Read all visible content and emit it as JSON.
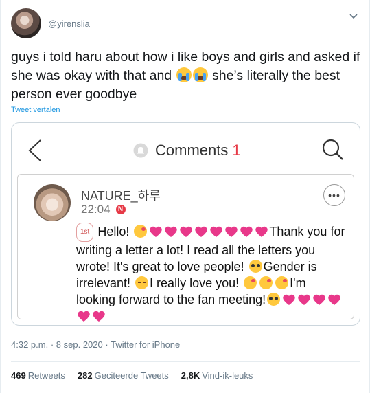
{
  "author": {
    "handle": "@yirenslia"
  },
  "tweet": {
    "text_part1": "guys i told haru about how i like boys and girls and asked if she was okay with that and",
    "text_part2": "she’s literally the best person ever goodbye",
    "emoji": "loudly-crying-face",
    "translate_label": "Tweet vertalen"
  },
  "screenshot": {
    "title": "Comments",
    "count": "1",
    "comment": {
      "name": "NATURE_하루",
      "time": "22:04",
      "new_badge": "N",
      "rank": "1st",
      "more_label": "•••",
      "line1": "Hello!",
      "line2": "Thank you for writing a letter a lot!  I read all the letters you wrote!  It's great to love people!",
      "line3": "Gender is irrelevant!",
      "line4": "I really love you!",
      "line5": "I'm looking forward to the fan meeting!"
    }
  },
  "meta": {
    "time": "4:32 p.m.",
    "date": "8 sep. 2020",
    "source": "Twitter for iPhone",
    "sep": "·"
  },
  "stats": {
    "retweets_count": "469",
    "retweets_label": "Retweets",
    "quotes_count": "282",
    "quotes_label": "Geciteerde Tweets",
    "likes_count": "2,8K",
    "likes_label": "Vind-ik-leuks"
  },
  "colors": {
    "link": "#1b95e0",
    "accent": "#e63946",
    "heart": "#e8388a"
  }
}
